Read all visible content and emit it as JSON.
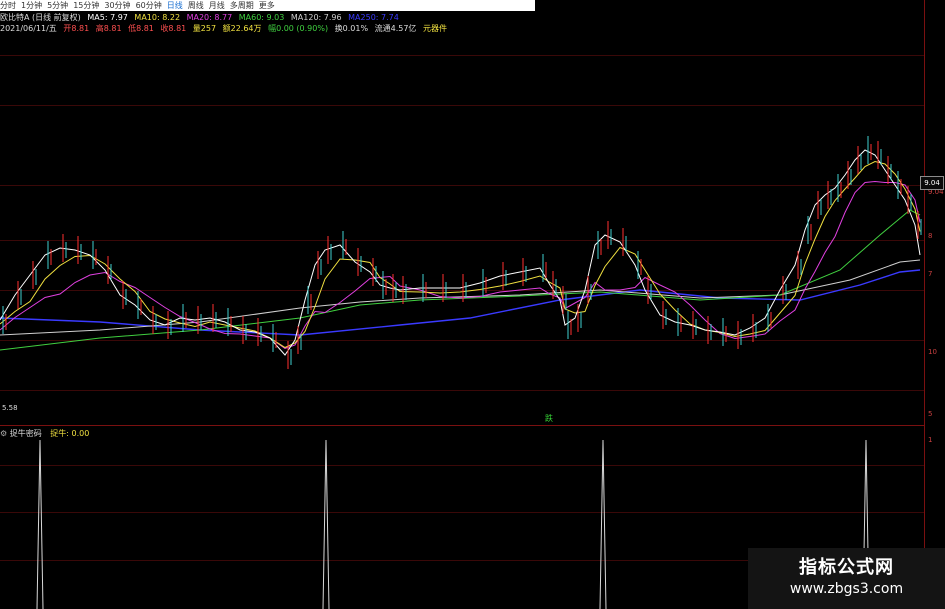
{
  "toolbar": {
    "items": [
      "分时",
      "1分钟",
      "5分钟",
      "15分钟",
      "30分钟",
      "60分钟",
      "日线",
      "周线",
      "月线",
      "多周期",
      "更多"
    ],
    "selected": "日线"
  },
  "info_line1": {
    "stock": "欧比特A (日线 前复权)",
    "ma5": "MA5: 7.97",
    "ma10": "MA10: 8.22",
    "ma20": "MA20: 8.77",
    "ma60": "MA60: 9.03",
    "ma120": "MA120: 7.96",
    "ma250": "MA250: 7.74"
  },
  "info_line2": {
    "date": "2021/06/11/五",
    "open": "开8.81",
    "high": "高8.81",
    "low": "低8.81",
    "close": "收8.81",
    "volume": "量257",
    "amount": "额22.64万",
    "change": "幅0.00 (0.90%)",
    "turnover": "换0.01%",
    "float": "流通4.57亿",
    "extra": "元器件"
  },
  "axis_labels": [
    "9.04",
    "8",
    "7",
    "10",
    "5",
    "1"
  ],
  "ma_box_value": "9.04",
  "low_label": "5.58",
  "signal_label": "跌",
  "sub_indicator": {
    "name": "捉牛密码",
    "value_label": "捉牛: 0.00"
  },
  "watermark": {
    "title": "指标公式网",
    "url": "www.zbgs3.com"
  },
  "colors": {
    "ma5": "#ffffff",
    "ma10": "#f0e040",
    "ma20": "#e040e0",
    "ma60": "#40d040",
    "ma120": "#d0d0d0",
    "ma250": "#3a3aff",
    "up": "#ff3030",
    "down": "#40d0d0"
  }
}
